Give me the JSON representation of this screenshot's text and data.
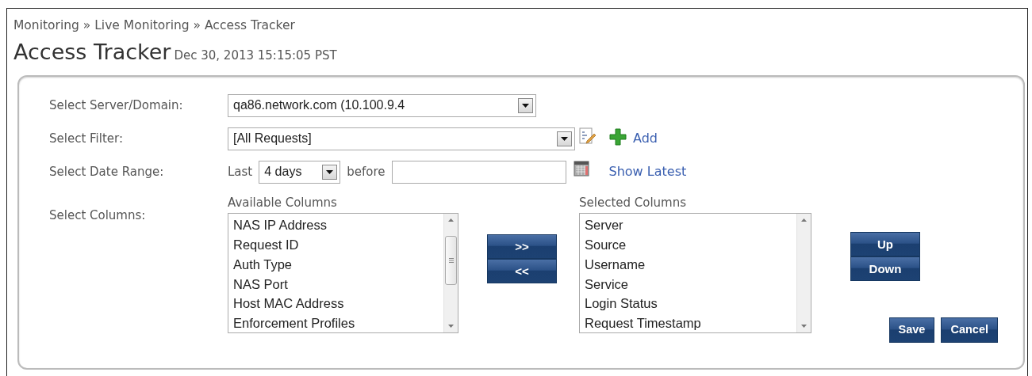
{
  "breadcrumb": "Monitoring » Live Monitoring » Access Tracker",
  "page_title": "Access Tracker",
  "timestamp": "Dec 30, 2013 15:15:05 PST",
  "server": {
    "label": "Select Server/Domain:",
    "value": "qa86.network.com (10.100.9.4"
  },
  "filter": {
    "label": "Select Filter:",
    "value": "[All Requests]",
    "add_link": "Add"
  },
  "date_range": {
    "label": "Select Date Range:",
    "prefix": "Last",
    "period": "4 days",
    "connector": "before",
    "show_latest_link": "Show Latest"
  },
  "columns": {
    "label": "Select Columns:",
    "available": {
      "heading": "Available Columns",
      "items": [
        "NAS IP Address",
        "Request ID",
        "Auth Type",
        "NAS Port",
        "Host MAC Address",
        "Enforcement Profiles"
      ]
    },
    "move_buttons": [
      ">>",
      "<<"
    ],
    "selected": {
      "heading": "Selected Columns",
      "items": [
        "Server",
        "Source",
        "Username",
        "Service",
        "Login Status",
        "Request Timestamp"
      ]
    },
    "order_buttons": [
      "Up",
      "Down"
    ]
  },
  "actions": [
    "Save",
    "Cancel"
  ]
}
